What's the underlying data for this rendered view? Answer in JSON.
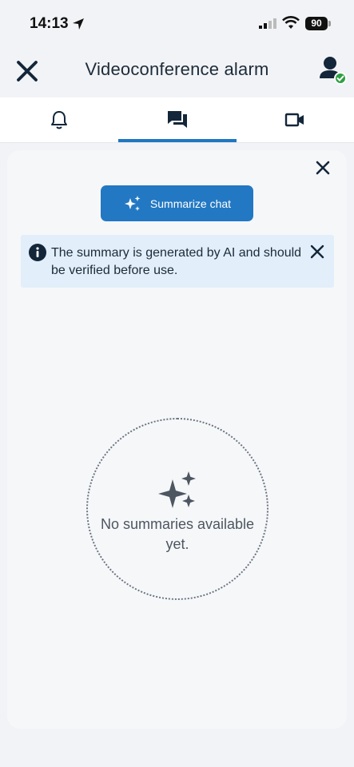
{
  "status_bar": {
    "time": "14:13",
    "battery": "90"
  },
  "header": {
    "title": "Videoconference alarm",
    "close_icon": "close-icon",
    "avatar_icon": "user-online-icon"
  },
  "tabs": [
    {
      "icon": "bell-icon",
      "active": false
    },
    {
      "icon": "chat-icon",
      "active": true
    },
    {
      "icon": "video-camera-icon",
      "active": false
    }
  ],
  "summary_panel": {
    "summarize_button": "Summarize chat",
    "notice": "The summary is generated by AI and should be verified before use.",
    "empty_state": "No summaries available yet."
  },
  "colors": {
    "accent": "#2378c3",
    "notice_bg": "#e2eef9",
    "online": "#2ea043"
  }
}
